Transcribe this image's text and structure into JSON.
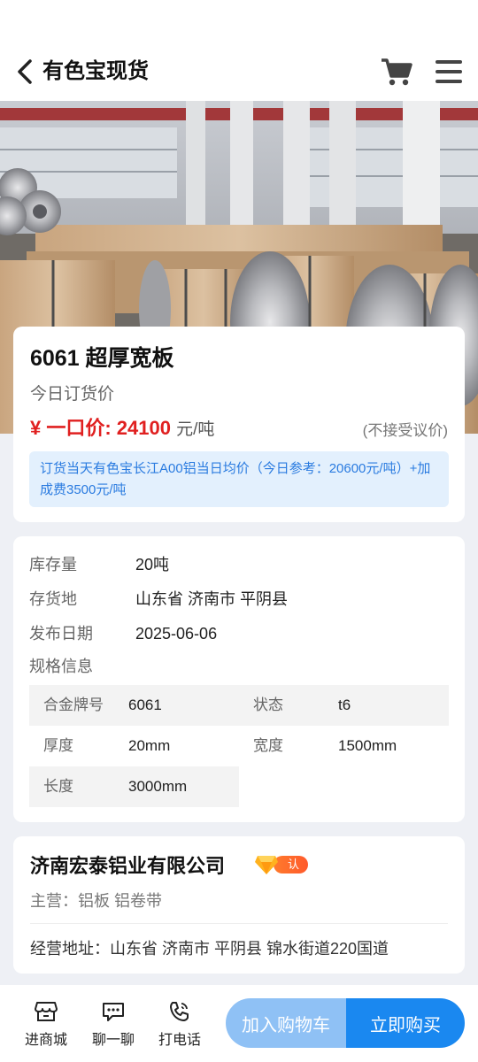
{
  "header": {
    "title": "有色宝现货",
    "back_icon": "chevron-left-icon",
    "cart_icon": "cart-icon",
    "menu_icon": "hamburger-menu-icon"
  },
  "product": {
    "name": "6061 超厚宽板",
    "price_label": "今日订货价",
    "price_prefix": "¥ 一口价: 24100",
    "price_unit": "元/吨",
    "no_bargain": "(不接受议价)",
    "note": "订货当天有色宝长江A00铝当日均价（今日参考：20600元/吨）+加成费3500元/吨"
  },
  "info": {
    "stock_label": "库存量",
    "stock_value": "20吨",
    "location_label": "存货地",
    "location_value": "山东省 济南市 平阴县",
    "date_label": "发布日期",
    "date_value": "2025-06-06",
    "spec_title": "规格信息",
    "specs": [
      {
        "k": "合金牌号",
        "v": "6061"
      },
      {
        "k": "状态",
        "v": "t6"
      },
      {
        "k": "厚度",
        "v": "20mm"
      },
      {
        "k": "宽度",
        "v": "1500mm"
      },
      {
        "k": "长度",
        "v": "3000mm"
      }
    ]
  },
  "company": {
    "name": "济南宏泰铝业有限公司",
    "badge": "认证",
    "main_business": "主营：铝板 铝卷带",
    "address": "经营地址：山东省 济南市 平阴县 锦水街道220国道"
  },
  "bottom_bar": {
    "shop_label": "进商城",
    "chat_label": "聊一聊",
    "call_label": "打电话",
    "add_cart_label": "加入购物车",
    "buy_label": "立即购买"
  },
  "colors": {
    "accent": "#1a88f0",
    "accent_light": "#8fc1f5",
    "price_red": "#e02020",
    "badge_orange": "#ff6a2c"
  }
}
